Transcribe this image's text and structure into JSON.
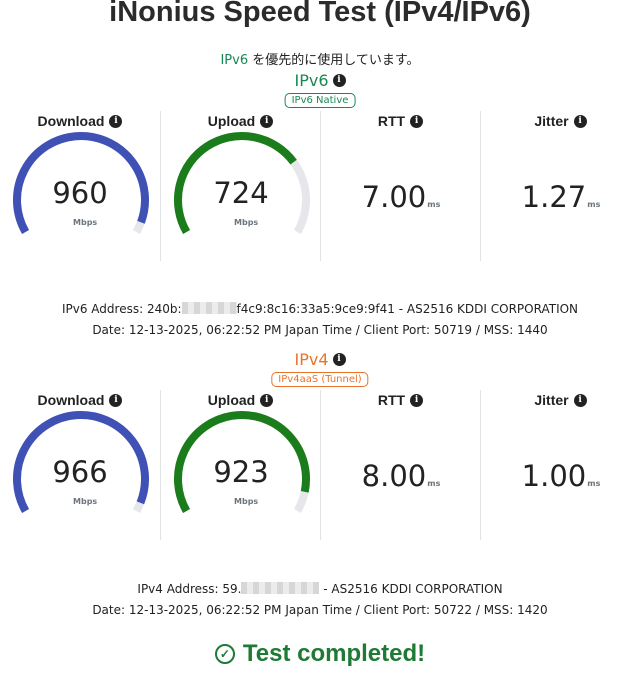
{
  "title": "iNonius Speed Test (IPv4/IPv6)",
  "notice": {
    "proto": "IPv6",
    "text": " を優先的に使用しています。"
  },
  "labels": {
    "download": "Download",
    "upload": "Upload",
    "rtt": "RTT",
    "jitter": "Jitter",
    "speed_unit": "Mbps",
    "ms_unit": "ms"
  },
  "gauge_max": 1000,
  "colors": {
    "download": "#3f51b5",
    "upload": "#1b7c1b",
    "track": "#e5e7ea"
  },
  "ipv6": {
    "title": "IPv6",
    "badge": "IPv6 Native",
    "download": 960,
    "upload": 724,
    "rtt": "7.00",
    "jitter": "1.27",
    "address_prefix": "IPv6 Address: 240b:",
    "address_suffix": "f4c9:8c16:33a5:9ce9:9f41 - AS2516 KDDI CORPORATION",
    "date_line": "Date: 12-13-2025, 06:22:52 PM Japan Time / Client Port: 50719 / MSS: 1440"
  },
  "ipv4": {
    "title": "IPv4",
    "badge": "IPv4aaS (Tunnel)",
    "download": 966,
    "upload": 923,
    "rtt": "8.00",
    "jitter": "1.00",
    "address_prefix": "IPv4 Address: 59.",
    "address_suffix": " - AS2516 KDDI CORPORATION",
    "date_line": "Date: 12-13-2025, 06:22:52 PM Japan Time / Client Port: 50722 / MSS: 1420"
  },
  "status": "Test completed!"
}
